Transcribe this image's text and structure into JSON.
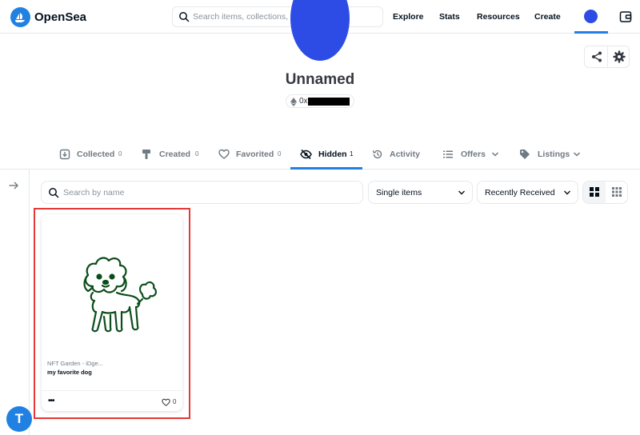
{
  "header": {
    "brand": "OpenSea",
    "search_placeholder": "Search items, collections, and accounts",
    "nav": [
      "Explore",
      "Stats",
      "Resources",
      "Create"
    ]
  },
  "profile": {
    "name": "Unnamed",
    "address_prefix": "0x"
  },
  "tabs": [
    {
      "label": "Collected",
      "count": "0"
    },
    {
      "label": "Created",
      "count": "0"
    },
    {
      "label": "Favorited",
      "count": "0"
    },
    {
      "label": "Hidden",
      "count": "1",
      "active": true
    },
    {
      "label": "Activity"
    },
    {
      "label": "Offers"
    },
    {
      "label": "Listings"
    }
  ],
  "filters": {
    "search_placeholder": "Search by name",
    "type_select": "Single items",
    "sort_select": "Recently Received"
  },
  "items": [
    {
      "collection": "NFT Garden - iDge...",
      "name": "my favorite dog",
      "likes": "0"
    }
  ],
  "floating_button_glyph": "T",
  "colors": {
    "accent": "#2081e2",
    "avatar": "#2d4ce5",
    "highlight": "#e53935",
    "drawing": "#0b4d1a"
  }
}
